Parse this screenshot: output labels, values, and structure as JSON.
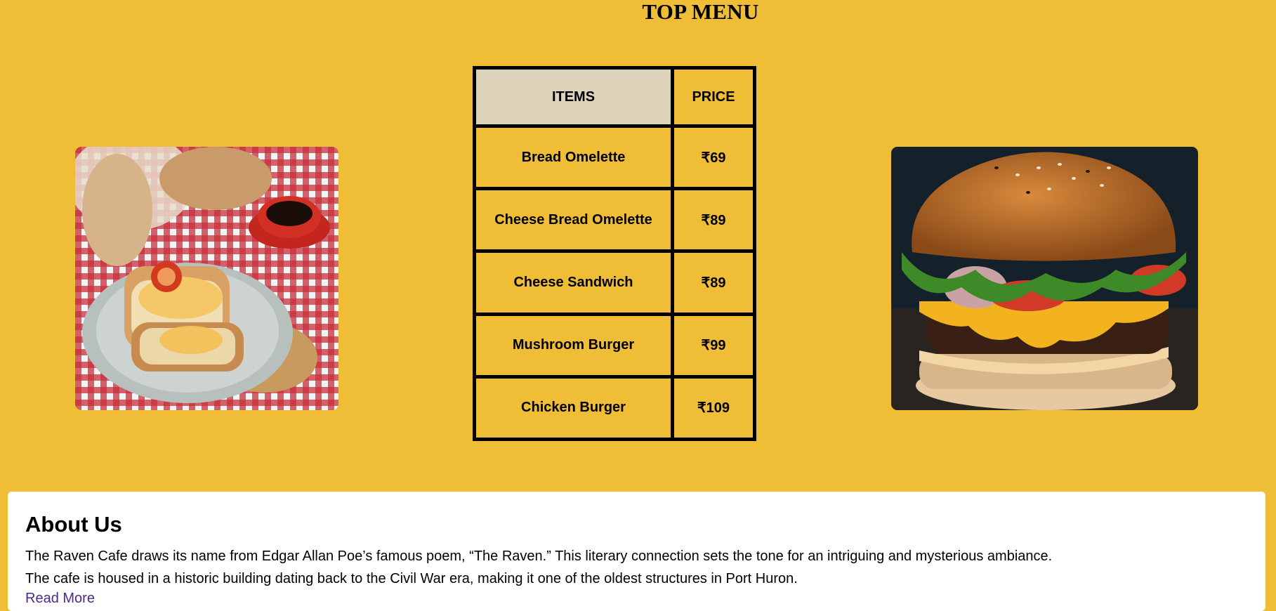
{
  "page": {
    "title": "TOP MENU"
  },
  "menu": {
    "headers": {
      "items": "ITEMS",
      "price": "PRICE"
    },
    "rows": [
      {
        "item": "Bread Omelette",
        "price": "₹69"
      },
      {
        "item": "Cheese Bread Omelette",
        "price": "₹89"
      },
      {
        "item": "Cheese Sandwich",
        "price": "₹89"
      },
      {
        "item": "Mushroom Burger",
        "price": "₹99"
      },
      {
        "item": "Chicken Burger",
        "price": "₹109"
      }
    ]
  },
  "images": {
    "left": "bread-omelette-photo",
    "right": "burger-photo"
  },
  "about": {
    "heading": "About Us",
    "paragraph1": "The Raven Cafe draws its name from Edgar Allan Poe’s famous poem, “The Raven.” This literary connection sets the tone for an intriguing and mysterious ambiance.",
    "paragraph2": "The cafe is housed in a historic building dating back to the Civil War era, making it one of the oldest structures in Port Huron.",
    "link": "Read More"
  },
  "colors": {
    "background": "#F0BE36",
    "header_cell": "#DDD4BB",
    "link": "#4B2A8E"
  }
}
